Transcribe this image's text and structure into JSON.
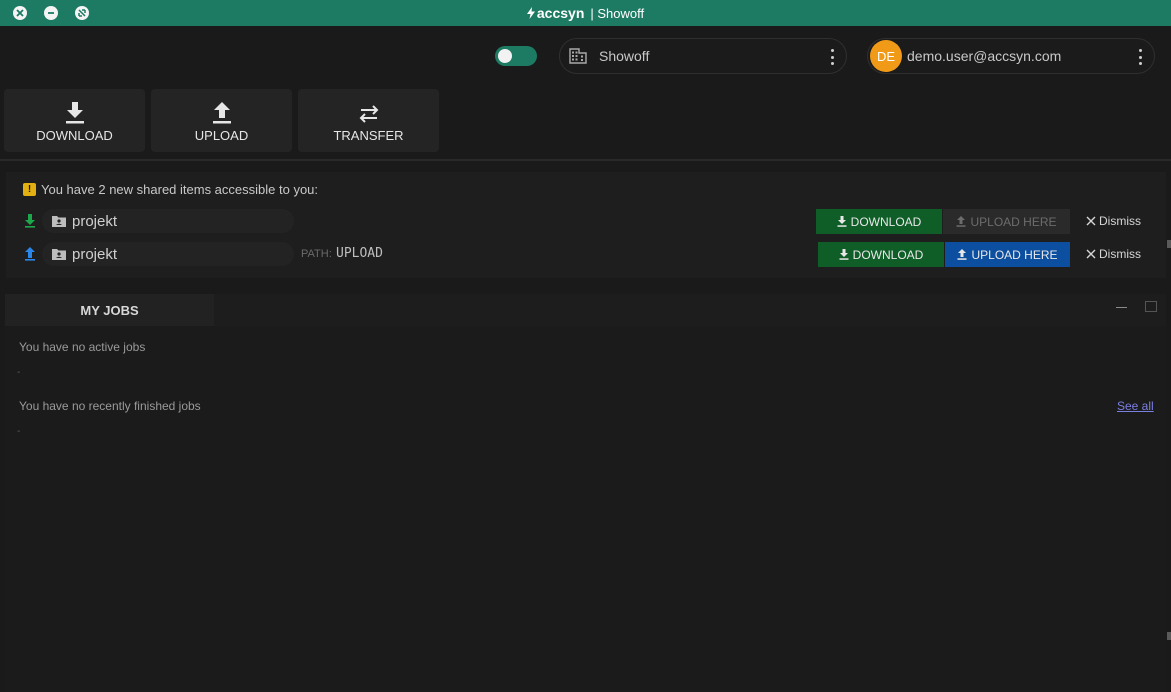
{
  "titlebar": {
    "logo_text": "accsyn",
    "title": "| Showoff"
  },
  "header": {
    "organization": "Showoff",
    "user_initials": "DE",
    "user_email": "demo.user@accsyn.com"
  },
  "toolbar": {
    "download_label": "DOWNLOAD",
    "upload_label": "UPLOAD",
    "transfer_label": "TRANSFER"
  },
  "shared": {
    "notice": "You have 2 new shared items accessible to you:",
    "items": [
      {
        "name": "projekt",
        "download_label": "DOWNLOAD",
        "upload_label": "UPLOAD HERE",
        "dismiss_label": "Dismiss"
      },
      {
        "name": "projekt",
        "path_label": "PATH:",
        "path_value": "UPLOAD",
        "download_label": "DOWNLOAD",
        "upload_label": "UPLOAD HERE",
        "dismiss_label": "Dismiss"
      }
    ]
  },
  "jobs": {
    "tab_label": "MY JOBS",
    "no_active": "You have no active jobs",
    "active_dash": "-",
    "no_finished": "You have no recently finished jobs",
    "finished_dash": "-",
    "see_all": "See all"
  },
  "colors": {
    "brand": "#1d7a63",
    "download": "#0f5e28",
    "upload": "#0c4ea0",
    "avatar": "#f09a17",
    "warning": "#e3b012"
  }
}
